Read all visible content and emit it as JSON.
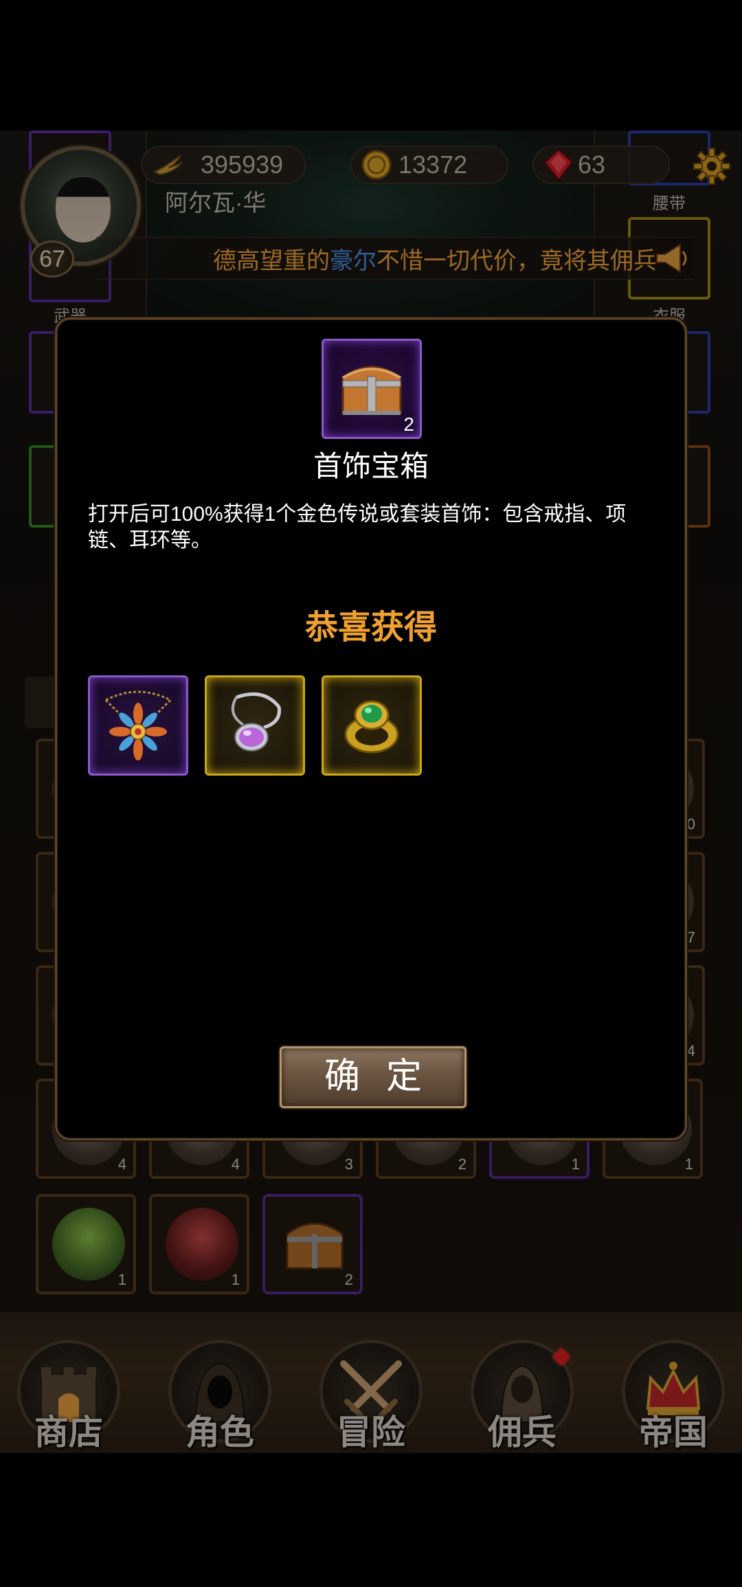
{
  "player": {
    "name": "阿尔瓦·华",
    "level": "67"
  },
  "resources": {
    "wings": "395939",
    "gold": "13372",
    "gems": "63"
  },
  "ticker": {
    "prefix": "德高望重的",
    "name": "豪尔",
    "suffix": "不惜一切代价，竟将其佣兵"
  },
  "equipment_labels": {
    "belt": "腰带",
    "weapon": "武器",
    "clothes": "衣服"
  },
  "inventory_counts": [
    "4",
    "4",
    "3",
    "2",
    "1",
    "1",
    "1",
    "1",
    "2"
  ],
  "inventory_side_counts": [
    "0",
    "7",
    "4"
  ],
  "dialog": {
    "item_name": "首饰宝箱",
    "item_count": "2",
    "description": "打开后可100%获得1个金色传说或套装首饰：包含戒指、项链、耳环等。",
    "congrats": "恭喜获得",
    "rewards": [
      {
        "name": "flower-pendant-necklace",
        "rarity": "purple"
      },
      {
        "name": "amethyst-pendant",
        "rarity": "gold"
      },
      {
        "name": "emerald-ring",
        "rarity": "gold"
      }
    ],
    "confirm_label": "确定"
  },
  "nav": [
    {
      "label": "商店",
      "icon": "castle-gate-icon"
    },
    {
      "label": "角色",
      "icon": "hooded-figure-icon"
    },
    {
      "label": "冒险",
      "icon": "crossed-swords-icon"
    },
    {
      "label": "佣兵",
      "icon": "mercenary-icon"
    },
    {
      "label": "帝国",
      "icon": "crown-icon"
    }
  ],
  "colors": {
    "accent_gold": "#f0a030",
    "highlight_blue": "#4b8fe8",
    "rarity_purple": "#8a5ac8",
    "rarity_gold": "#c8a818"
  }
}
